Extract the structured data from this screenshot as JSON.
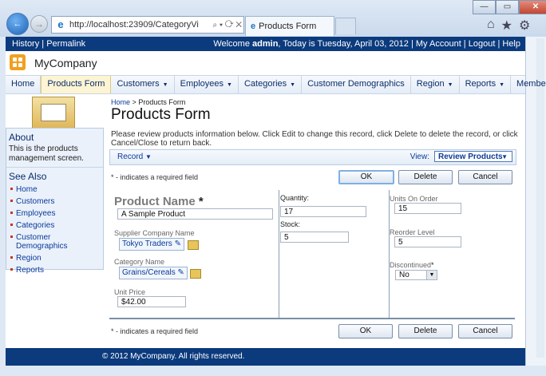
{
  "browser": {
    "url": "http://localhost:23909/CategoryVi",
    "url_controls": "⌕ ▾ ⟳ ✕",
    "tab_title": "Products Form",
    "win_min": "—",
    "win_max": "▭",
    "win_close": "✕",
    "icons": [
      "home-icon",
      "favorites-icon",
      "tools-icon"
    ]
  },
  "topbar": {
    "history": "History",
    "permalink": "Permalink",
    "welcome_prefix": "Welcome ",
    "user": "admin",
    "welcome_suffix": ", Today is Tuesday, April 03, 2012",
    "my_account": "My Account",
    "logout": "Logout",
    "help": "Help"
  },
  "header": {
    "company": "MyCompany"
  },
  "menu": [
    {
      "label": "Home",
      "dropdown": false
    },
    {
      "label": "Products Form",
      "dropdown": false,
      "active": true
    },
    {
      "label": "Customers",
      "dropdown": true
    },
    {
      "label": "Employees",
      "dropdown": true
    },
    {
      "label": "Categories",
      "dropdown": true
    },
    {
      "label": "Customer Demographics",
      "dropdown": false
    },
    {
      "label": "Region",
      "dropdown": true
    },
    {
      "label": "Reports",
      "dropdown": true
    },
    {
      "label": "Membership",
      "dropdown": false
    }
  ],
  "sidebar": {
    "about_title": "About",
    "about_text": "This is the products management screen.",
    "see_also_title": "See Also",
    "links": [
      "Home",
      "Customers",
      "Employees",
      "Categories",
      "Customer Demographics",
      "Region",
      "Reports"
    ]
  },
  "breadcrumb": {
    "home": "Home",
    "sep": ">",
    "current": "Products Form"
  },
  "page": {
    "title": "Products Form",
    "description": "Please review products information below. Click Edit to change this record, click Delete to delete the record, or click Cancel/Close to return back."
  },
  "actionbar": {
    "record": "Record",
    "view_label": "View:",
    "view_value": "Review Products"
  },
  "form": {
    "required_note": "* - indicates a required field",
    "buttons": {
      "ok": "OK",
      "delete": "Delete",
      "cancel": "Cancel"
    },
    "product_name_label": "Product Name",
    "required_star": "*",
    "product_name": "A Sample Product",
    "supplier_label": "Supplier Company Name",
    "supplier": "Tokyo Traders",
    "category_label": "Category Name",
    "category": "Grains/Cereals",
    "unit_price_label": "Unit Price",
    "unit_price": "$42.00",
    "quantity_label": "Quantity:",
    "quantity": "17",
    "stock_label": "Stock:",
    "stock": "5",
    "units_on_order_label": "Units On Order",
    "units_on_order": "15",
    "reorder_label": "Reorder Level",
    "reorder": "5",
    "discontinued_label": "Discontinued",
    "discontinued": "No"
  },
  "footer": {
    "text": "© 2012 MyCompany. All rights reserved."
  }
}
